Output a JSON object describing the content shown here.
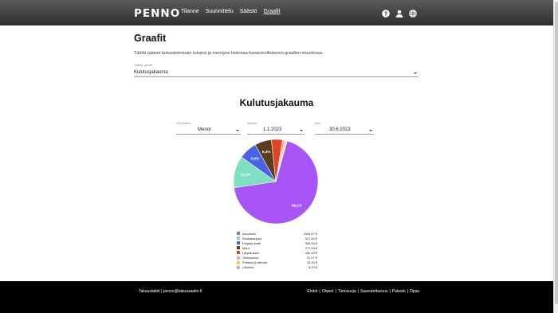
{
  "header": {
    "logo": "PENNO",
    "nav": [
      "Tilanne",
      "Suunnittelu",
      "Säästö",
      "Graafit"
    ],
    "active_nav": "Graafit",
    "icons": [
      "help-icon",
      "user-icon",
      "globe-icon"
    ]
  },
  "main": {
    "title": "Graafit",
    "intro": "Täältä pääset tarkastelemaan tulojesi ja menojesi historiaa havainnollistavien graafien muodossa.",
    "chart_select": {
      "label": "Valitse graafi",
      "value": "Kulutusjakauma"
    },
    "chart_title": "Kulutusjakauma",
    "filters": {
      "type": {
        "label": "Tulo/Meno",
        "value": "Menot"
      },
      "from": {
        "label": "Alkaen",
        "value": "1.1.2023"
      },
      "to": {
        "label": "Asti",
        "value": "30.6.2023"
      }
    }
  },
  "chart_data": {
    "type": "pie",
    "slices": [
      {
        "name": "Asuminen",
        "value": 2944.67,
        "amount": "2944,67 €",
        "pct_label": "68,2%",
        "color": "#a855f7"
      },
      {
        "name": "Ruokakauppa",
        "value": 527.5,
        "amount": "527,50 €",
        "pct_label": "12,2%",
        "color": "#7ee0c0"
      },
      {
        "name": "Prepaid-kortti",
        "value": 300.0,
        "amount": "300,00 €",
        "pct_label": "6,9%",
        "color": "#4a63e6"
      },
      {
        "name": "Muut",
        "value": 277.94,
        "amount": "277,94 €",
        "pct_label": "6,4%",
        "color": "#5a3d1c"
      },
      {
        "name": "Lahjoitukset",
        "value": 182.4,
        "amount": "182,40 €",
        "pct_label": "",
        "color": "#e0461f"
      },
      {
        "name": "Oikeuskulut",
        "value": 37.57,
        "amount": "37,57 €",
        "pct_label": "",
        "color": "#f59ad9"
      },
      {
        "name": "Puhelin ja internet",
        "value": 29.3,
        "amount": "29,30 €",
        "pct_label": "",
        "color": "#f2d13a"
      },
      {
        "name": "Liikenne",
        "value": 8.2,
        "amount": "8,20 €",
        "pct_label": "",
        "color": "#b9b9b9"
      }
    ]
  },
  "footer": {
    "contact": "Takuusäätiö | penno@takuusaatio.fi",
    "links": [
      "Ehdot",
      "Ohjeet",
      "Tietosuoja",
      "Saavutettavuus",
      "Palaute",
      "Opas"
    ]
  }
}
